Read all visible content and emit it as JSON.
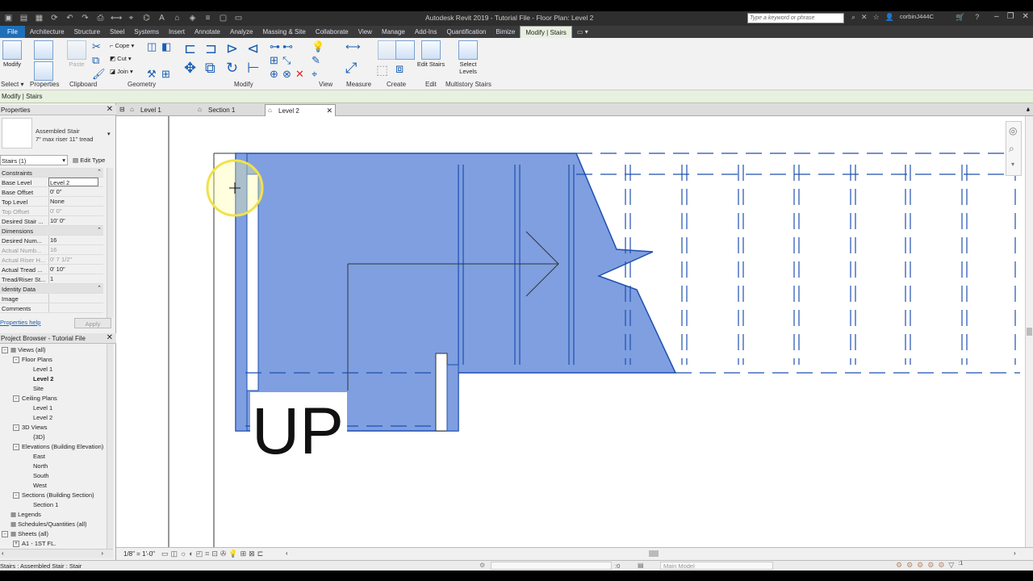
{
  "window": {
    "title": "Autodesk Revit 2019 - Tutorial File - Floor Plan: Level 2",
    "search_placeholder": "Type a keyword or phrase",
    "user": "corbinJ444C"
  },
  "ribbon_tabs": [
    "File",
    "Architecture",
    "Structure",
    "Steel",
    "Systems",
    "Insert",
    "Annotate",
    "Analyze",
    "Massing & Site",
    "Collaborate",
    "View",
    "Manage",
    "Add-Ins",
    "Quantification",
    "Bimize",
    "Modify | Stairs"
  ],
  "ribbon": {
    "modify_label": "Modify",
    "paste_label": "Paste",
    "cope_label": "Cope",
    "cut_label": "Cut",
    "join_label": "Join",
    "edit_stairs_label": "Edit Stairs",
    "select_levels_label": "Select Levels",
    "panels": {
      "select": "Select",
      "properties": "Properties",
      "clipboard": "Clipboard",
      "geometry": "Geometry",
      "modify": "Modify",
      "view": "View",
      "measure": "Measure",
      "create": "Create",
      "edit": "Edit",
      "multistory": "Multistory Stairs"
    }
  },
  "context_bar": "Modify | Stairs",
  "properties": {
    "header": "Properties",
    "type_name": "Assembled Stair",
    "type_sub": "7\" max riser 11\" tread",
    "selector": "Stairs (1)",
    "edit_type": "Edit Type",
    "groups": {
      "constraints": "Constraints",
      "dimensions": "Dimensions",
      "identity": "Identity Data"
    },
    "rows_constraints": [
      {
        "k": "Base Level",
        "v": "Level 2",
        "dim": false
      },
      {
        "k": "Base Offset",
        "v": "0'  0\"",
        "dim": false
      },
      {
        "k": "Top Level",
        "v": "None",
        "dim": false
      },
      {
        "k": "Top Offset",
        "v": "0'  0\"",
        "dim": true
      },
      {
        "k": "Desired Stair ...",
        "v": "10'  0\"",
        "dim": false
      }
    ],
    "rows_dimensions": [
      {
        "k": "Desired Num...",
        "v": "16",
        "dim": false
      },
      {
        "k": "Actual Numb...",
        "v": "16",
        "dim": true
      },
      {
        "k": "Actual Riser H...",
        "v": "0'  7 1/2\"",
        "dim": true
      },
      {
        "k": "Actual Tread ...",
        "v": "0'  10\"",
        "dim": false
      },
      {
        "k": "Tread/Riser St...",
        "v": "1",
        "dim": false
      }
    ],
    "rows_identity": [
      {
        "k": "Image",
        "v": ""
      },
      {
        "k": "Comments",
        "v": ""
      }
    ],
    "help_link": "Properties help",
    "apply": "Apply"
  },
  "project_browser": {
    "header": "Project Browser - Tutorial File",
    "items": [
      {
        "label": "Views (all)",
        "indent": 0,
        "toggle": "-",
        "bold": false
      },
      {
        "label": "Floor Plans",
        "indent": 1,
        "toggle": "-",
        "bold": false
      },
      {
        "label": "Level 1",
        "indent": 2,
        "toggle": "",
        "bold": false
      },
      {
        "label": "Level 2",
        "indent": 2,
        "toggle": "",
        "bold": true
      },
      {
        "label": "Site",
        "indent": 2,
        "toggle": "",
        "bold": false
      },
      {
        "label": "Ceiling Plans",
        "indent": 1,
        "toggle": "-",
        "bold": false
      },
      {
        "label": "Level 1",
        "indent": 2,
        "toggle": "",
        "bold": false
      },
      {
        "label": "Level 2",
        "indent": 2,
        "toggle": "",
        "bold": false
      },
      {
        "label": "3D Views",
        "indent": 1,
        "toggle": "-",
        "bold": false
      },
      {
        "label": "{3D}",
        "indent": 2,
        "toggle": "",
        "bold": false
      },
      {
        "label": "Elevations (Building Elevation)",
        "indent": 1,
        "toggle": "-",
        "bold": false
      },
      {
        "label": "East",
        "indent": 2,
        "toggle": "",
        "bold": false
      },
      {
        "label": "North",
        "indent": 2,
        "toggle": "",
        "bold": false
      },
      {
        "label": "South",
        "indent": 2,
        "toggle": "",
        "bold": false
      },
      {
        "label": "West",
        "indent": 2,
        "toggle": "",
        "bold": false
      },
      {
        "label": "Sections (Building Section)",
        "indent": 1,
        "toggle": "-",
        "bold": false
      },
      {
        "label": "Section 1",
        "indent": 2,
        "toggle": "",
        "bold": false
      },
      {
        "label": "Legends",
        "indent": 0,
        "toggle": "",
        "bold": false
      },
      {
        "label": "Schedules/Quantities (all)",
        "indent": 0,
        "toggle": "",
        "bold": false
      },
      {
        "label": "Sheets (all)",
        "indent": 0,
        "toggle": "-",
        "bold": false
      },
      {
        "label": "A1 - 1ST FL.",
        "indent": 1,
        "toggle": "+",
        "bold": false
      }
    ]
  },
  "view_tabs": [
    {
      "label": "Level 1",
      "active": false
    },
    {
      "label": "Section 1",
      "active": false
    },
    {
      "label": "Level 2",
      "active": true
    }
  ],
  "canvas": {
    "stair_label": "UP"
  },
  "view_bar": {
    "scale": "1/8\" = 1'-0\""
  },
  "status": {
    "text": "Stairs : Assembled Stair : Stair",
    "workset_value": ":0",
    "model": "Main Model"
  },
  "colors": {
    "stair_fill": "#7f9fe0",
    "stair_line": "#1f4fb0",
    "ribbon_context": "#e8f0df",
    "file_tab": "#1f6fb8"
  }
}
